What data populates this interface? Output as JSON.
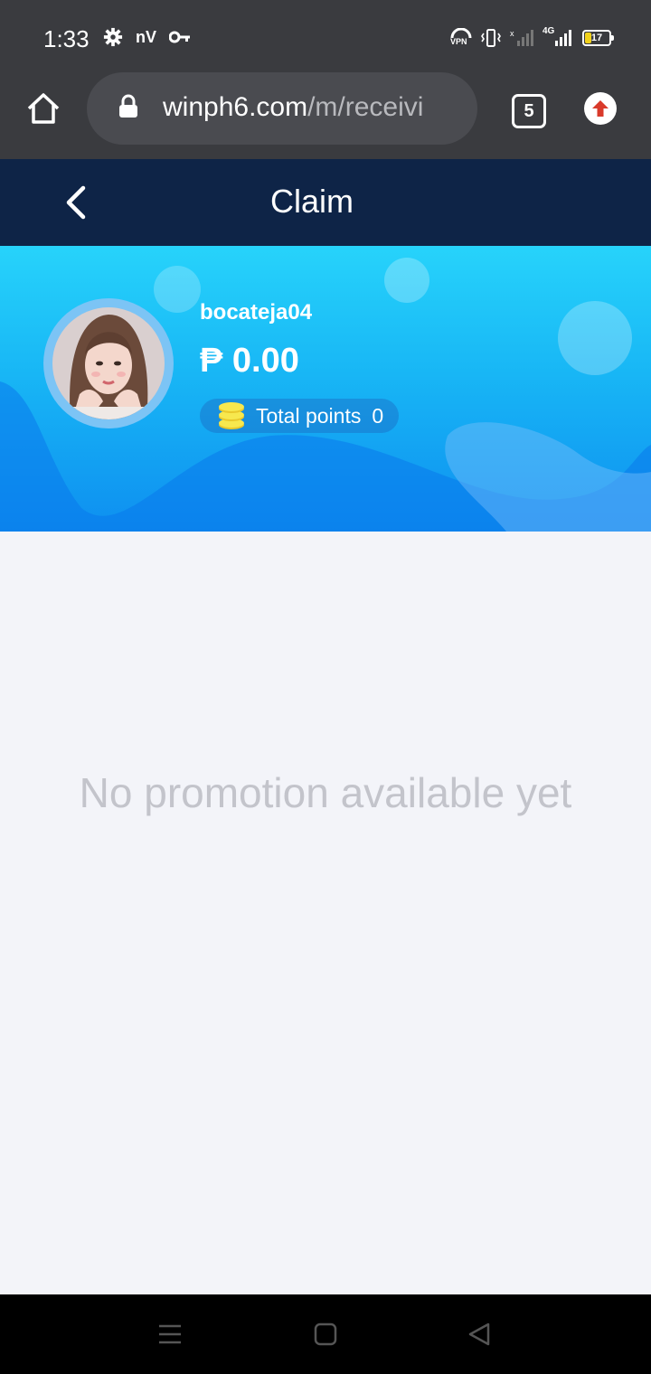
{
  "status_bar": {
    "time": "1:33",
    "carrier_label": "nV",
    "network_label": "4G",
    "vpn_label": "VPN",
    "battery_level": "17"
  },
  "browser": {
    "home_icon": "home-icon",
    "url_domain": "winph6.com",
    "url_path": "/m/receivi",
    "tab_count": "5",
    "update_icon": "arrow-up-icon"
  },
  "header": {
    "back_icon": "chevron-left-icon",
    "title": "Claim"
  },
  "profile": {
    "username": "bocateja04",
    "balance": "₱ 0.00",
    "points_label": "Total points",
    "points_value": "0"
  },
  "main": {
    "empty_message": "No promotion available yet"
  },
  "colors": {
    "header_bg": "#0e2447",
    "banner_top": "#27d3fb",
    "banner_bottom": "#0e8ff0",
    "coin": "#f7e84e"
  }
}
